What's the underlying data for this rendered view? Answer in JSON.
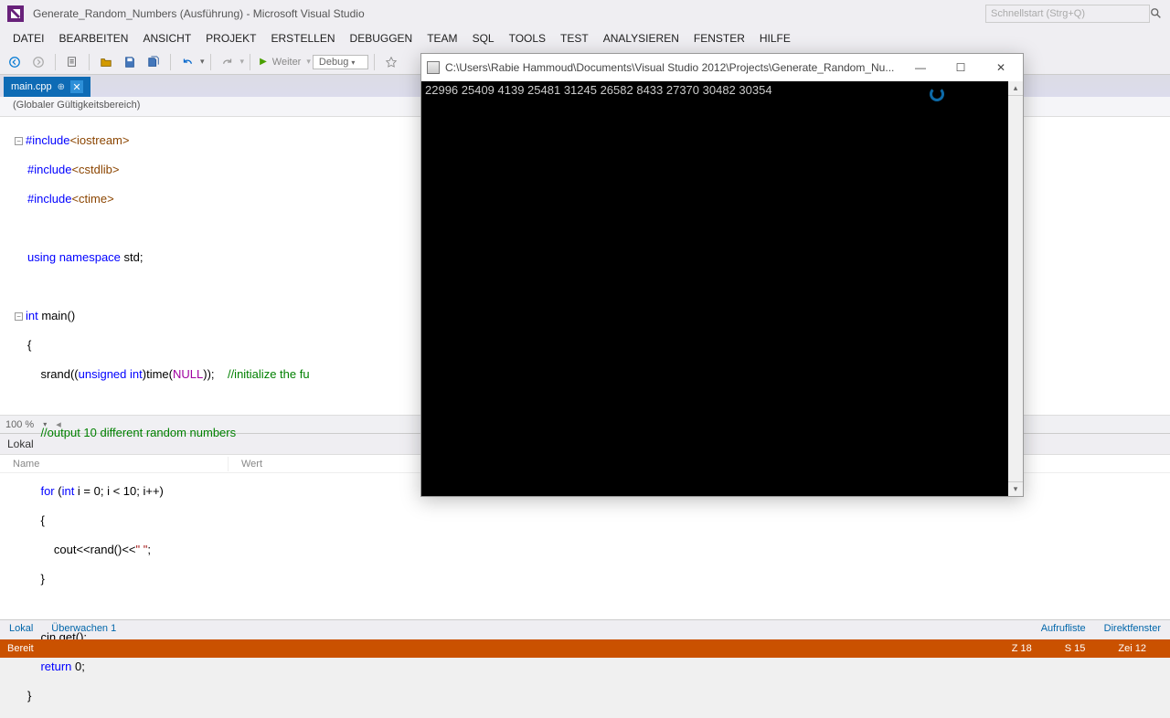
{
  "title": "Generate_Random_Numbers (Ausführung) - Microsoft Visual Studio",
  "quick_launch_placeholder": "Schnellstart (Strg+Q)",
  "menu": [
    "DATEI",
    "BEARBEITEN",
    "ANSICHT",
    "PROJEKT",
    "ERSTELLEN",
    "DEBUGGEN",
    "TEAM",
    "SQL",
    "TOOLS",
    "TEST",
    "ANALYSIEREN",
    "FENSTER",
    "HILFE"
  ],
  "toolbar": {
    "continue_label": "Weiter",
    "config": "Debug"
  },
  "tab": {
    "name": "main.cpp",
    "pinned": true
  },
  "scope": "(Globaler Gültigkeitsbereich)",
  "zoom": "100 %",
  "lokal": {
    "title": "Lokal",
    "col_name": "Name",
    "col_wert": "Wert"
  },
  "bottom_tabs_left": [
    "Lokal",
    "Überwachen 1"
  ],
  "bottom_tabs_right": [
    "Aufrufliste",
    "Direktfenster"
  ],
  "status": {
    "ready": "Bereit",
    "z": "Z 18",
    "s": "S 15",
    "ze": "Zei 12"
  },
  "console": {
    "path": "C:\\Users\\Rabie Hammoud\\Documents\\Visual Studio 2012\\Projects\\Generate_Random_Nu...",
    "output": "22996 25409 4139 25481 31245 26582 8433 27370 30482 30354"
  },
  "code": {
    "l1a": "#include",
    "l1b": "<iostream>",
    "l2a": "#include",
    "l2b": "<cstdlib>",
    "l3a": "#include",
    "l3b": "<ctime>",
    "l5a": "using",
    "l5b": "namespace",
    "l5c": " std;",
    "l7a": "int",
    "l7b": " main()",
    "l8": "{",
    "l9a": "    srand((",
    "l9b": "unsigned",
    "l9c": " ",
    "l9d": "int",
    "l9e": ")time(",
    "l9f": "NULL",
    "l9g": "));    ",
    "l9h": "//initialize the fu",
    "l11": "    //output 10 different random numbers",
    "l13a": "    ",
    "l13b": "for",
    "l13c": " (",
    "l13d": "int",
    "l13e": " i = 0; i < 10; i++)",
    "l14": "    {",
    "l15a": "        cout<<rand()<<",
    "l15b": "\" \"",
    "l15c": ";",
    "l16": "    }",
    "l18": "    cin.get();",
    "l19a": "    ",
    "l19b": "return",
    "l19c": " 0;",
    "l20": "}"
  }
}
